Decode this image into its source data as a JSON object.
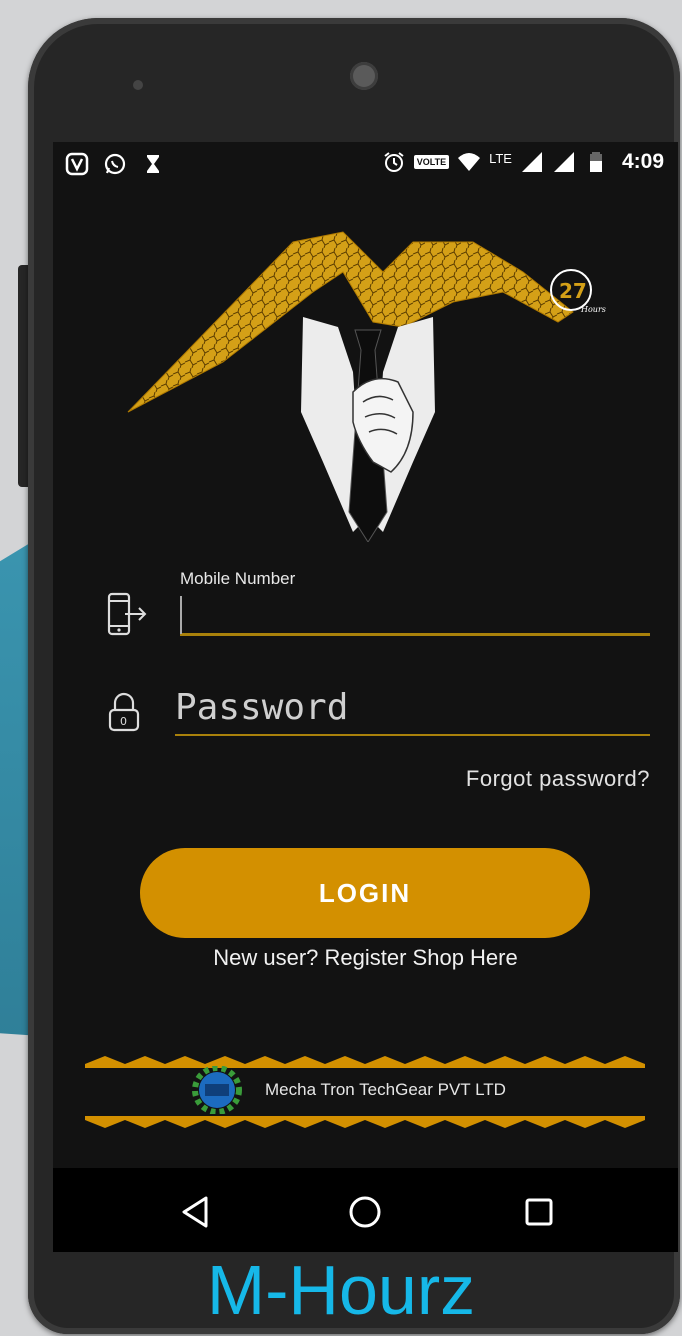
{
  "status_bar": {
    "time": "4:09",
    "volte": "VOLTE",
    "network": "LTE",
    "left_icons": [
      "saavn-icon",
      "whatsapp-icon",
      "hourglass-icon"
    ],
    "right_icons": [
      "alarm-icon",
      "volte-icon",
      "wifi-icon",
      "signal-icon",
      "signal-icon-2",
      "battery-icon"
    ]
  },
  "logo": {
    "badge": "27",
    "badge_sub": "Hours"
  },
  "form": {
    "mobile_label": "Mobile  Number",
    "mobile_value": "",
    "password_placeholder": "Password",
    "forgot_label": "Forgot password?",
    "login_label": "LOGIN",
    "register_label": "New user? Register Shop Here"
  },
  "footer": {
    "company": "Mecha Tron TechGear PVT LTD"
  },
  "nav": {
    "back": "back-icon",
    "home": "home-icon",
    "recents": "recents-icon"
  },
  "brand_caption": "M-Hourz",
  "colors": {
    "accent": "#d39000",
    "underline": "#a9810b",
    "screen_bg": "#121212",
    "brand_text": "#16b8e8",
    "logo_gold": "#d4a017"
  }
}
